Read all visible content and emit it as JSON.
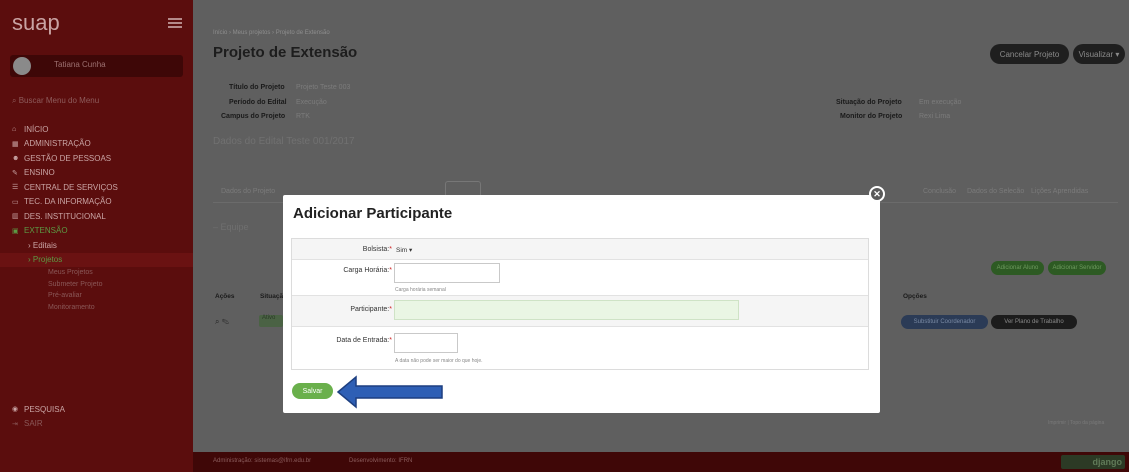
{
  "sidebar": {
    "logo": "suap",
    "user_name": "Tatiana Cunha",
    "search_placeholder": "Buscar Menu do Menu",
    "items": [
      {
        "label": "INÍCIO",
        "icon": "home-icon",
        "glyph": "⌂"
      },
      {
        "label": "ADMINISTRAÇÃO",
        "icon": "briefcase-icon",
        "glyph": "▦"
      },
      {
        "label": "GESTÃO DE PESSOAS",
        "icon": "people-icon",
        "glyph": "☻"
      },
      {
        "label": "ENSINO",
        "icon": "pencil-icon",
        "glyph": "✎"
      },
      {
        "label": "CENTRAL DE SERVIÇOS",
        "icon": "list-icon",
        "glyph": "☰"
      },
      {
        "label": "TEC. DA INFORMAÇÃO",
        "icon": "monitor-icon",
        "glyph": "▭"
      },
      {
        "label": "DES. INSTITUCIONAL",
        "icon": "chart-icon",
        "glyph": "▥"
      },
      {
        "label": "EXTENSÃO",
        "icon": "extension-icon",
        "glyph": "▣"
      }
    ],
    "sub_items": [
      "› Editais",
      "› Projetos"
    ],
    "sub2_items": [
      "Meus Projetos",
      "Submeter Projeto",
      "Pré-avaliar",
      "Monitoramento"
    ],
    "bottom_items": [
      {
        "label": "PESQUISA",
        "icon": "search-circle-icon",
        "glyph": "◉"
      },
      {
        "label": "SAIR",
        "icon": "logout-icon",
        "glyph": "⇥"
      }
    ]
  },
  "header": {
    "breadcrumb": "Início › Meus projetos › Projeto de Extensão",
    "title": "Projeto de Extensão",
    "cancel_button": "Cancelar Projeto",
    "view_button": "Visualizar ▾"
  },
  "project_info": {
    "left": [
      {
        "label": "Título do Projeto",
        "value": "Projeto Teste 003"
      },
      {
        "label": "Período do Edital",
        "value": "Execução"
      },
      {
        "label": "Campus do Projeto",
        "value": "RTK"
      }
    ],
    "right": [
      {
        "label": "Situação do Projeto",
        "value": "Em execução"
      },
      {
        "label": "Monitor do Projeto",
        "value": "Rexi Lima"
      }
    ]
  },
  "edital": "Dados do Edital Teste 001/2017",
  "tabs": [
    "Dados do Projeto",
    "Caracterização dos Beneficiários",
    "Equipe",
    "Metas/Atividades",
    "Plano de Aplicação",
    "Plano de Desembolso",
    "Anexos",
    "Fotos",
    "Conclusão",
    "Dados do Selecão",
    "Lições Aprendidas"
  ],
  "equipe_label": "Equipe",
  "equipe_buttons": {
    "add_member": "Adicionar Aluno",
    "add_server": "Adicionar Servidor"
  },
  "table_headers": {
    "acoes": "Ações",
    "situacao": "Situação",
    "opcoes": "Opções"
  },
  "row": {
    "status": "Ativo",
    "substitute": "Substituir Coordenador",
    "plan": "Ver Plano de Trabalho"
  },
  "pager": "Imprimir  |  Topo da página",
  "footer": {
    "admin": "Administração: sistemas@ifrn.edu.br",
    "dev": "Desenvolvimento: IFRN",
    "badge": "django"
  },
  "modal": {
    "title": "Adicionar Participante",
    "bolsista_label": "Bolsista:",
    "bolsista_value": "Sim ▾",
    "carga_label": "Carga Horária:",
    "carga_value": "",
    "carga_help": "Carga horária semanal",
    "participante_label": "Participante:",
    "participante_value": "",
    "data_label": "Data de Entrada:",
    "data_value": "",
    "data_help": "A data não pode ser maior do que hoje.",
    "required_mark": "*",
    "save_button": "Salvar",
    "close_glyph": "✕"
  },
  "colors": {
    "sidebar": "#5b0d0d",
    "save": "#6ab04c",
    "arrow": "#2e5fb5"
  }
}
